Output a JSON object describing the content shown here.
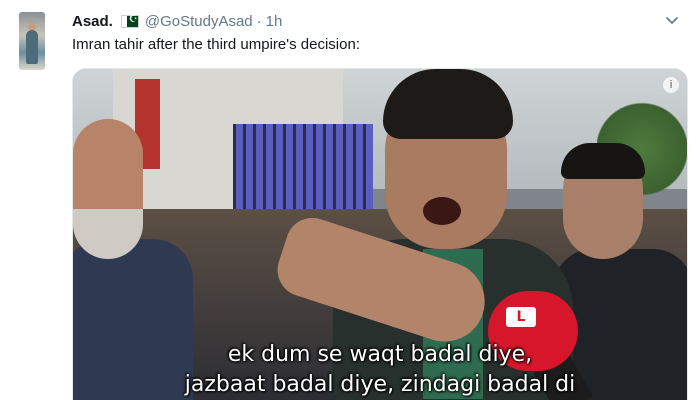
{
  "tweet": {
    "display_name": "Asad.",
    "flag_icon": "pakistan-flag-icon",
    "handle": "@GoStudyAsad",
    "separator": "·",
    "time": "1h",
    "text": "Imran tahir after the third umpire's decision:",
    "caret_icon": "chevron-down-icon"
  },
  "media": {
    "subtitle_line_1": "ek dum se waqt badal diye,",
    "subtitle_line_2": "jazbaat badal diye, zindagi badal di",
    "badge": "i",
    "mic_logo": "L"
  },
  "colors": {
    "name": "#14171a",
    "meta": "#657786",
    "border": "#e1e8ed",
    "mic_red": "#d6162a"
  }
}
